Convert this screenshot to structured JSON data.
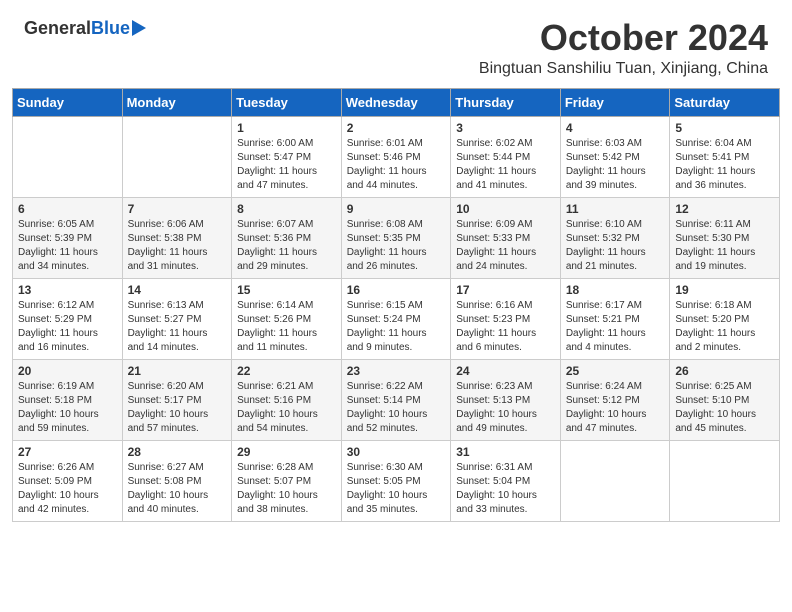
{
  "header": {
    "logo_general": "General",
    "logo_blue": "Blue",
    "month_title": "October 2024",
    "location": "Bingtuan Sanshiliu Tuan, Xinjiang, China"
  },
  "calendar": {
    "days_of_week": [
      "Sunday",
      "Monday",
      "Tuesday",
      "Wednesday",
      "Thursday",
      "Friday",
      "Saturday"
    ],
    "weeks": [
      [
        {
          "day": "",
          "sunrise": "",
          "sunset": "",
          "daylight": ""
        },
        {
          "day": "",
          "sunrise": "",
          "sunset": "",
          "daylight": ""
        },
        {
          "day": "1",
          "sunrise": "Sunrise: 6:00 AM",
          "sunset": "Sunset: 5:47 PM",
          "daylight": "Daylight: 11 hours and 47 minutes."
        },
        {
          "day": "2",
          "sunrise": "Sunrise: 6:01 AM",
          "sunset": "Sunset: 5:46 PM",
          "daylight": "Daylight: 11 hours and 44 minutes."
        },
        {
          "day": "3",
          "sunrise": "Sunrise: 6:02 AM",
          "sunset": "Sunset: 5:44 PM",
          "daylight": "Daylight: 11 hours and 41 minutes."
        },
        {
          "day": "4",
          "sunrise": "Sunrise: 6:03 AM",
          "sunset": "Sunset: 5:42 PM",
          "daylight": "Daylight: 11 hours and 39 minutes."
        },
        {
          "day": "5",
          "sunrise": "Sunrise: 6:04 AM",
          "sunset": "Sunset: 5:41 PM",
          "daylight": "Daylight: 11 hours and 36 minutes."
        }
      ],
      [
        {
          "day": "6",
          "sunrise": "Sunrise: 6:05 AM",
          "sunset": "Sunset: 5:39 PM",
          "daylight": "Daylight: 11 hours and 34 minutes."
        },
        {
          "day": "7",
          "sunrise": "Sunrise: 6:06 AM",
          "sunset": "Sunset: 5:38 PM",
          "daylight": "Daylight: 11 hours and 31 minutes."
        },
        {
          "day": "8",
          "sunrise": "Sunrise: 6:07 AM",
          "sunset": "Sunset: 5:36 PM",
          "daylight": "Daylight: 11 hours and 29 minutes."
        },
        {
          "day": "9",
          "sunrise": "Sunrise: 6:08 AM",
          "sunset": "Sunset: 5:35 PM",
          "daylight": "Daylight: 11 hours and 26 minutes."
        },
        {
          "day": "10",
          "sunrise": "Sunrise: 6:09 AM",
          "sunset": "Sunset: 5:33 PM",
          "daylight": "Daylight: 11 hours and 24 minutes."
        },
        {
          "day": "11",
          "sunrise": "Sunrise: 6:10 AM",
          "sunset": "Sunset: 5:32 PM",
          "daylight": "Daylight: 11 hours and 21 minutes."
        },
        {
          "day": "12",
          "sunrise": "Sunrise: 6:11 AM",
          "sunset": "Sunset: 5:30 PM",
          "daylight": "Daylight: 11 hours and 19 minutes."
        }
      ],
      [
        {
          "day": "13",
          "sunrise": "Sunrise: 6:12 AM",
          "sunset": "Sunset: 5:29 PM",
          "daylight": "Daylight: 11 hours and 16 minutes."
        },
        {
          "day": "14",
          "sunrise": "Sunrise: 6:13 AM",
          "sunset": "Sunset: 5:27 PM",
          "daylight": "Daylight: 11 hours and 14 minutes."
        },
        {
          "day": "15",
          "sunrise": "Sunrise: 6:14 AM",
          "sunset": "Sunset: 5:26 PM",
          "daylight": "Daylight: 11 hours and 11 minutes."
        },
        {
          "day": "16",
          "sunrise": "Sunrise: 6:15 AM",
          "sunset": "Sunset: 5:24 PM",
          "daylight": "Daylight: 11 hours and 9 minutes."
        },
        {
          "day": "17",
          "sunrise": "Sunrise: 6:16 AM",
          "sunset": "Sunset: 5:23 PM",
          "daylight": "Daylight: 11 hours and 6 minutes."
        },
        {
          "day": "18",
          "sunrise": "Sunrise: 6:17 AM",
          "sunset": "Sunset: 5:21 PM",
          "daylight": "Daylight: 11 hours and 4 minutes."
        },
        {
          "day": "19",
          "sunrise": "Sunrise: 6:18 AM",
          "sunset": "Sunset: 5:20 PM",
          "daylight": "Daylight: 11 hours and 2 minutes."
        }
      ],
      [
        {
          "day": "20",
          "sunrise": "Sunrise: 6:19 AM",
          "sunset": "Sunset: 5:18 PM",
          "daylight": "Daylight: 10 hours and 59 minutes."
        },
        {
          "day": "21",
          "sunrise": "Sunrise: 6:20 AM",
          "sunset": "Sunset: 5:17 PM",
          "daylight": "Daylight: 10 hours and 57 minutes."
        },
        {
          "day": "22",
          "sunrise": "Sunrise: 6:21 AM",
          "sunset": "Sunset: 5:16 PM",
          "daylight": "Daylight: 10 hours and 54 minutes."
        },
        {
          "day": "23",
          "sunrise": "Sunrise: 6:22 AM",
          "sunset": "Sunset: 5:14 PM",
          "daylight": "Daylight: 10 hours and 52 minutes."
        },
        {
          "day": "24",
          "sunrise": "Sunrise: 6:23 AM",
          "sunset": "Sunset: 5:13 PM",
          "daylight": "Daylight: 10 hours and 49 minutes."
        },
        {
          "day": "25",
          "sunrise": "Sunrise: 6:24 AM",
          "sunset": "Sunset: 5:12 PM",
          "daylight": "Daylight: 10 hours and 47 minutes."
        },
        {
          "day": "26",
          "sunrise": "Sunrise: 6:25 AM",
          "sunset": "Sunset: 5:10 PM",
          "daylight": "Daylight: 10 hours and 45 minutes."
        }
      ],
      [
        {
          "day": "27",
          "sunrise": "Sunrise: 6:26 AM",
          "sunset": "Sunset: 5:09 PM",
          "daylight": "Daylight: 10 hours and 42 minutes."
        },
        {
          "day": "28",
          "sunrise": "Sunrise: 6:27 AM",
          "sunset": "Sunset: 5:08 PM",
          "daylight": "Daylight: 10 hours and 40 minutes."
        },
        {
          "day": "29",
          "sunrise": "Sunrise: 6:28 AM",
          "sunset": "Sunset: 5:07 PM",
          "daylight": "Daylight: 10 hours and 38 minutes."
        },
        {
          "day": "30",
          "sunrise": "Sunrise: 6:30 AM",
          "sunset": "Sunset: 5:05 PM",
          "daylight": "Daylight: 10 hours and 35 minutes."
        },
        {
          "day": "31",
          "sunrise": "Sunrise: 6:31 AM",
          "sunset": "Sunset: 5:04 PM",
          "daylight": "Daylight: 10 hours and 33 minutes."
        },
        {
          "day": "",
          "sunrise": "",
          "sunset": "",
          "daylight": ""
        },
        {
          "day": "",
          "sunrise": "",
          "sunset": "",
          "daylight": ""
        }
      ]
    ]
  }
}
